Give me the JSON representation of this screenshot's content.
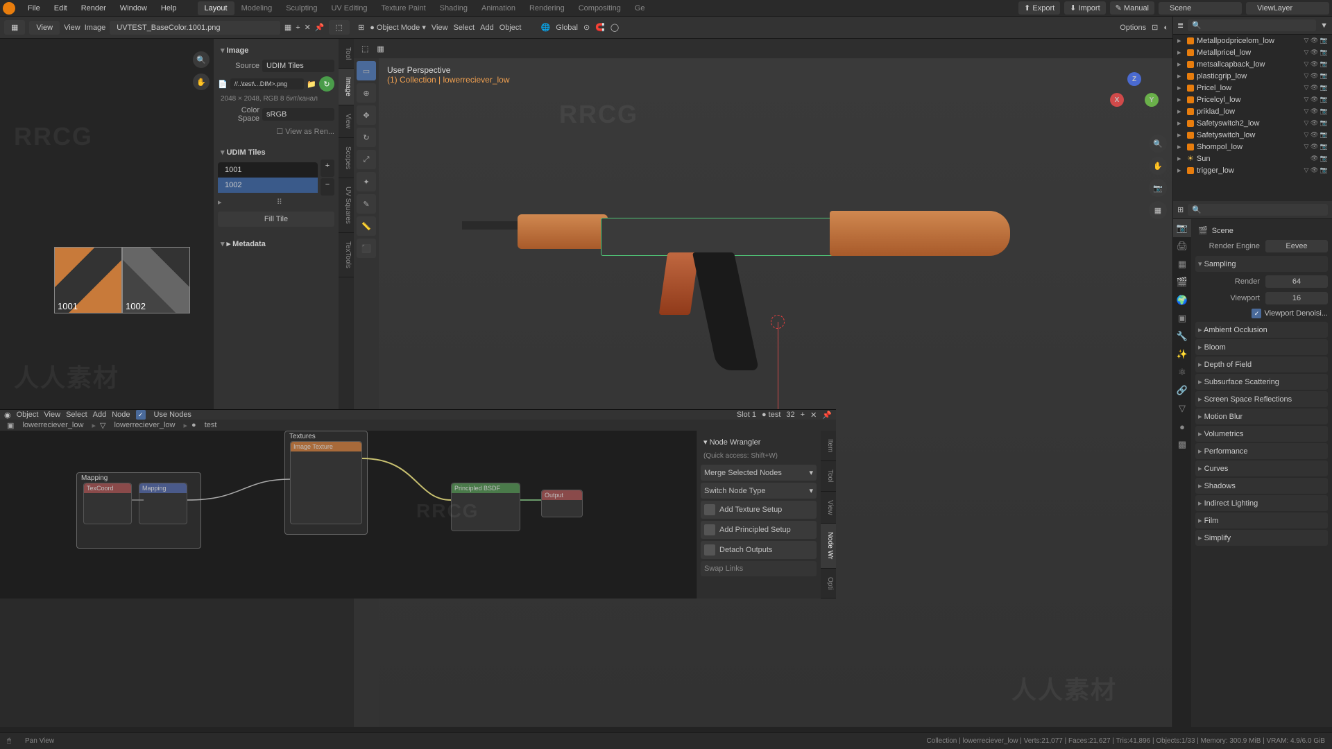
{
  "top_menu": {
    "items": [
      "File",
      "Edit",
      "Render",
      "Window",
      "Help"
    ],
    "tabs": [
      "Layout",
      "Modeling",
      "Sculpting",
      "UV Editing",
      "Texture Paint",
      "Shading",
      "Animation",
      "Rendering",
      "Compositing",
      "Ge"
    ],
    "active_tab": 0,
    "export": "Export",
    "import": "Import",
    "manual": "Manual",
    "scene": "Scene",
    "viewlayer": "ViewLayer"
  },
  "uv_header": {
    "view": "View",
    "view2": "View",
    "image": "Image",
    "img_name": "UVTEST_BaseColor.1001.png"
  },
  "image_panel": {
    "title": "Image",
    "source_lbl": "Source",
    "source_val": "UDIM Tiles",
    "path": "//..\\test\\...DIM>.png",
    "dims": "2048 × 2048, RGB 8 бит/канал",
    "cs_lbl": "Color Space",
    "cs_val": "sRGB",
    "view_as": "View as Ren...",
    "udim_title": "UDIM Tiles",
    "tiles": [
      "1001",
      "1002"
    ],
    "fill": "Fill Tile",
    "meta": "Metadata"
  },
  "uv_thumbs": {
    "t1": "1001",
    "t2": "1002"
  },
  "uv_vtabs": [
    "Tool",
    "Image",
    "View",
    "Scopes",
    "UV Squares",
    "TexTools"
  ],
  "vp_header": {
    "mode": "Object Mode",
    "view": "View",
    "select": "Select",
    "add": "Add",
    "object": "Object",
    "orient": "Global"
  },
  "vp_info": {
    "l1": "User Perspective",
    "l2": "(1) Collection | lowerreciever_low"
  },
  "vp_options": "Options",
  "gizmo": {
    "x": "X",
    "y": "Y",
    "z": "Z"
  },
  "node_header": {
    "obj": "Object",
    "view": "View",
    "select": "Select",
    "add": "Add",
    "node": "Node",
    "use_nodes": "Use Nodes",
    "slot": "Slot 1",
    "mat": "test",
    "count": "32"
  },
  "breadcrumb": {
    "b1": "lowerreciever_low",
    "b2": "lowerreciever_low",
    "b3": "test"
  },
  "node_frames": {
    "mapping": "Mapping",
    "textures": "Textures"
  },
  "node_wrangler": {
    "title": "Node Wrangler",
    "quick": "(Quick access: Shift+W)",
    "merge": "Merge Selected Nodes",
    "switch": "Switch Node Type",
    "add_tex": "Add Texture Setup",
    "add_prin": "Add Principled Setup",
    "detach": "Detach Outputs",
    "swap": "Swap Links"
  },
  "node_vtabs": [
    "Item",
    "Tool",
    "View",
    "Node Wr",
    "Opti"
  ],
  "outliner": {
    "items": [
      {
        "name": "Metallpodpricelom_low"
      },
      {
        "name": "Metallpricel_low"
      },
      {
        "name": "metsallcapback_low"
      },
      {
        "name": "plasticgrip_low"
      },
      {
        "name": "Pricel_low"
      },
      {
        "name": "Pricelcyl_low"
      },
      {
        "name": "priklad_low"
      },
      {
        "name": "Safetyswitch2_low"
      },
      {
        "name": "Safetyswitch_low"
      },
      {
        "name": "Shompol_low"
      },
      {
        "name": "Sun",
        "light": true
      },
      {
        "name": "trigger_low"
      }
    ]
  },
  "props": {
    "scene": "Scene",
    "engine_lbl": "Render Engine",
    "engine": "Eevee",
    "sampling": "Sampling",
    "render_lbl": "Render",
    "render": "64",
    "viewport_lbl": "Viewport",
    "viewport": "16",
    "denoise": "Viewport Denoisi...",
    "sections": [
      "Ambient Occlusion",
      "Bloom",
      "Depth of Field",
      "Subsurface Scattering",
      "Screen Space Reflections",
      "Motion Blur",
      "Volumetrics",
      "Performance",
      "Curves",
      "Shadows",
      "Indirect Lighting",
      "Film",
      "Simplify"
    ]
  },
  "status": {
    "left": "Pan View",
    "right": "Collection | lowerreciever_low | Verts:21,077 | Faces:21,627 | Tris:41,896 | Objects:1/33 | Memory: 300.9 MiB | VRAM: 4.9/6.0 GiB"
  }
}
